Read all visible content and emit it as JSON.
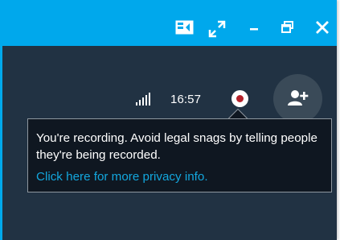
{
  "titlebar": {
    "background": "#00a8ec",
    "buttons": [
      {
        "name": "split-view-icon"
      },
      {
        "name": "fullscreen-icon"
      },
      {
        "name": "minimize-icon"
      },
      {
        "name": "restore-icon"
      },
      {
        "name": "close-icon"
      }
    ]
  },
  "call": {
    "background": "#213243",
    "signal_icon": "signal-strength-icon",
    "duration": "16:57",
    "record_button_icon": "record-icon",
    "record_color": "#b5222b",
    "add_person_icon": "add-person-icon"
  },
  "tooltip": {
    "message": "You're recording. Avoid legal snags by telling people they're being recorded.",
    "link_text": "Click here for more privacy info.",
    "link_color": "#13a7de",
    "background": "#0f1721"
  }
}
